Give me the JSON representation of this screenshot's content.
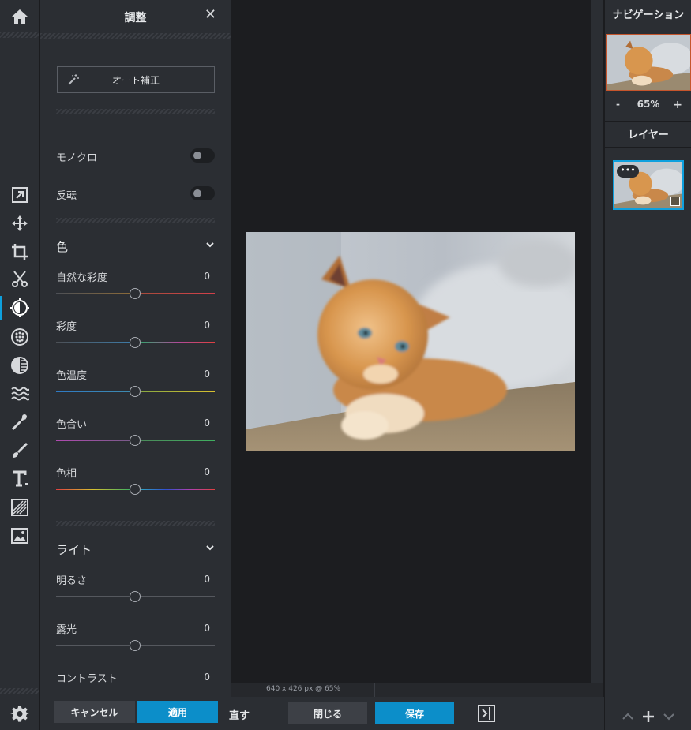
{
  "panel": {
    "title": "調整",
    "close": "✕",
    "auto_fix": "オート補正",
    "toggles": [
      {
        "label": "モノクロ",
        "on": false
      },
      {
        "label": "反転",
        "on": false
      }
    ],
    "color_section": {
      "title": "色",
      "sliders": [
        {
          "label": "自然な彩度",
          "value": "0"
        },
        {
          "label": "彩度",
          "value": "0"
        },
        {
          "label": "色温度",
          "value": "0"
        },
        {
          "label": "色合い",
          "value": "0"
        },
        {
          "label": "色相",
          "value": "0"
        }
      ]
    },
    "light_section": {
      "title": "ライト",
      "sliders": [
        {
          "label": "明るさ",
          "value": "0"
        },
        {
          "label": "露光",
          "value": "0"
        },
        {
          "label": "コントラスト",
          "value": "0"
        }
      ]
    },
    "cancel": "キャンセル",
    "apply": "適用"
  },
  "canvas": {
    "status": "640 x 426 px @ 65%"
  },
  "bottombar": {
    "redo": "直す",
    "close": "閉じる",
    "save": "保存"
  },
  "navigation": {
    "title": "ナビゲーション",
    "zoom_minus": "-",
    "zoom": "65%",
    "zoom_plus": "+"
  },
  "layers": {
    "title": "レイヤー",
    "more": "•••"
  },
  "colors": {
    "accent": "#0c8ec9",
    "panel_bg": "#2b2e33",
    "canvas_bg": "#1c1d20",
    "nav_border": "#c6552c"
  },
  "icons": [
    "home-icon",
    "export-icon",
    "move-icon",
    "crop-icon",
    "cut-icon",
    "adjust-icon",
    "effects-icon",
    "filter-icon",
    "liquify-icon",
    "retouch-icon",
    "brush-icon",
    "text-icon",
    "pattern-icon",
    "image-icon",
    "settings-icon"
  ]
}
